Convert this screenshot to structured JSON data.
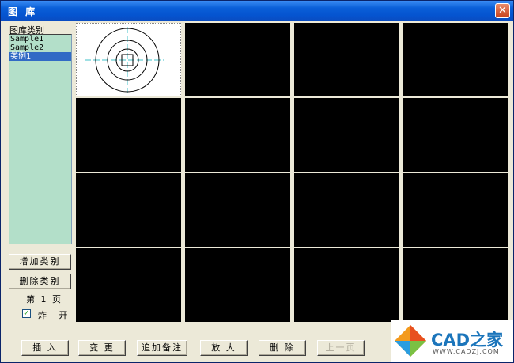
{
  "window": {
    "title": "图 库",
    "close_glyph": "✕"
  },
  "category_label": "图库类别",
  "categories": [
    {
      "label": "Sample1",
      "selected": false
    },
    {
      "label": "Sample2",
      "selected": false
    },
    {
      "label": "类例1",
      "selected": true
    }
  ],
  "left_buttons": {
    "add_category": "增加类别",
    "delete_category": "删除类别"
  },
  "page_label": "第 1 页",
  "explode": {
    "label": "炸 开",
    "checked": true,
    "check_glyph": "✓"
  },
  "bottom_buttons": [
    {
      "name": "insert-button",
      "label": "插 入",
      "enabled": true
    },
    {
      "name": "change-button",
      "label": "变 更",
      "enabled": true
    },
    {
      "name": "add-note-button",
      "label": "追加备注",
      "enabled": true
    },
    {
      "name": "zoom-in-button",
      "label": "放 大",
      "enabled": true
    },
    {
      "name": "delete-button",
      "label": "删 除",
      "enabled": true
    },
    {
      "name": "prev-page-button",
      "label": "上一页",
      "enabled": false
    }
  ],
  "watermark": {
    "text": "CAD之家",
    "url": "WWW.CADZJ.COM"
  },
  "colors": {
    "title_bar": "#0554d0",
    "list_bg": "#b3dfc9",
    "selection": "#316ac5",
    "preview_bg": "#ffffff",
    "empty_cell": "#000000"
  }
}
